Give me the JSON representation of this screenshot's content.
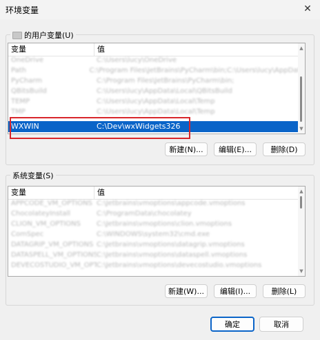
{
  "window": {
    "title": "环境变量"
  },
  "user_vars": {
    "group_label": "的用户变量(U)",
    "headers": {
      "name": "变量",
      "value": "值"
    },
    "rows": [
      {
        "name": "OneDrive",
        "value": "C:\\Users\\lucy\\OneDrive"
      },
      {
        "name": "Path",
        "value": "C:\\Program Files\\JetBrains\\PyCharm\\bin;C:\\Users\\lucy\\AppData\\Local"
      },
      {
        "name": "PyCharm",
        "value": "C:\\Program Files\\JetBrains\\PyCharm\\bin;"
      },
      {
        "name": "QBitsBuild",
        "value": "C:\\Users\\lucy\\AppData\\Local\\QBitsBuild"
      },
      {
        "name": "TEMP",
        "value": "C:\\Users\\lucy\\AppData\\Local\\Temp"
      },
      {
        "name": "TMP",
        "value": "C:\\Users\\lucy\\AppData\\Local\\Temp"
      }
    ],
    "selected": {
      "name": "WXWIN",
      "value": "C:\\Dev\\wxWidgets326"
    },
    "buttons": {
      "new": "新建(N)...",
      "edit": "编辑(E)...",
      "delete": "删除(D)"
    }
  },
  "system_vars": {
    "group_label": "系统变量(S)",
    "headers": {
      "name": "变量",
      "value": "值"
    },
    "rows": [
      {
        "name": "APPCODE_VM_OPTIONS",
        "value": "C:\\Jetbrains\\vmoptions\\appcode.vmoptions"
      },
      {
        "name": "ChocolateyInstall",
        "value": "C:\\ProgramData\\chocolatey"
      },
      {
        "name": "CLION_VM_OPTIONS",
        "value": "C:\\Jetbrains\\vmoptions\\clion.vmoptions"
      },
      {
        "name": "ComSpec",
        "value": "C:\\WINDOWS\\system32\\cmd.exe"
      },
      {
        "name": "DATAGRIP_VM_OPTIONS",
        "value": "C:\\Jetbrains\\vmoptions\\datagrip.vmoptions"
      },
      {
        "name": "DATASPELL_VM_OPTIONS",
        "value": "C:\\Jetbrains\\vmoptions\\dataspell.vmoptions"
      },
      {
        "name": "DEVECOSTUDIO_VM_OPTIONS",
        "value": "C:\\Jetbrains\\vmoptions\\devecostudio.vmoptions"
      }
    ],
    "buttons": {
      "new": "新建(W)...",
      "edit": "编辑(I)...",
      "delete": "删除(L)"
    }
  },
  "footer": {
    "ok": "确定",
    "cancel": "取消"
  },
  "colors": {
    "selection": "#0a64c8",
    "highlight": "#d8262b"
  }
}
